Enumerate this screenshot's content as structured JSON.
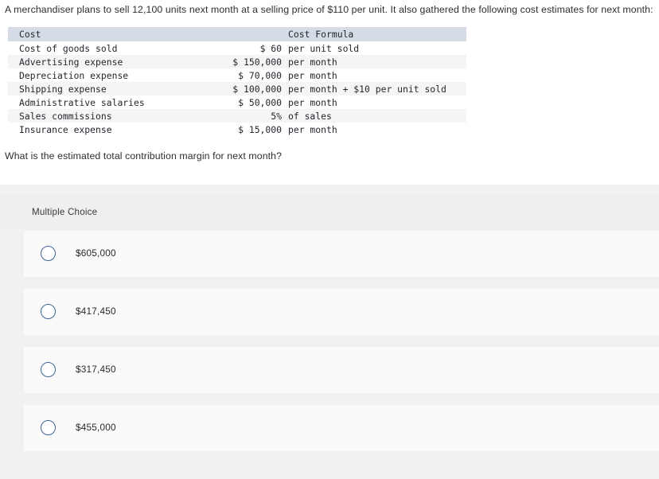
{
  "question": {
    "stem": "A merchandiser plans to sell 12,100 units next month at a selling price of $110 per unit. It also gathered the following cost estimates for next month:",
    "sub_question": "What is the estimated total contribution margin for next month?"
  },
  "cost_table": {
    "headers": [
      "Cost",
      "Cost Formula"
    ],
    "rows": [
      {
        "cost": "Cost of goods sold",
        "amount": "$ 60",
        "unit": "per unit sold"
      },
      {
        "cost": "Advertising expense",
        "amount": "$ 150,000",
        "unit": "per month"
      },
      {
        "cost": "Depreciation expense",
        "amount": "$ 70,000",
        "unit": "per month"
      },
      {
        "cost": "Shipping expense",
        "amount": "$ 100,000",
        "unit": "per month + $10 per unit sold"
      },
      {
        "cost": "Administrative salaries",
        "amount": "$ 50,000",
        "unit": "per month"
      },
      {
        "cost": "Sales commissions",
        "amount": "5%",
        "unit": "of sales"
      },
      {
        "cost": "Insurance expense",
        "amount": "$ 15,000",
        "unit": "per month"
      }
    ],
    "header_bg": "#d6dce5",
    "stripe_bg": "#f5f5f5"
  },
  "answer_section": {
    "type_label": "Multiple Choice",
    "panel_bg": "#f1f1f1",
    "option_bg": "#fafafa",
    "radio_color": "#3d6495",
    "options": [
      {
        "label": "$605,000",
        "selected": false
      },
      {
        "label": "$417,450",
        "selected": false
      },
      {
        "label": "$317,450",
        "selected": false
      },
      {
        "label": "$455,000",
        "selected": false
      }
    ]
  }
}
